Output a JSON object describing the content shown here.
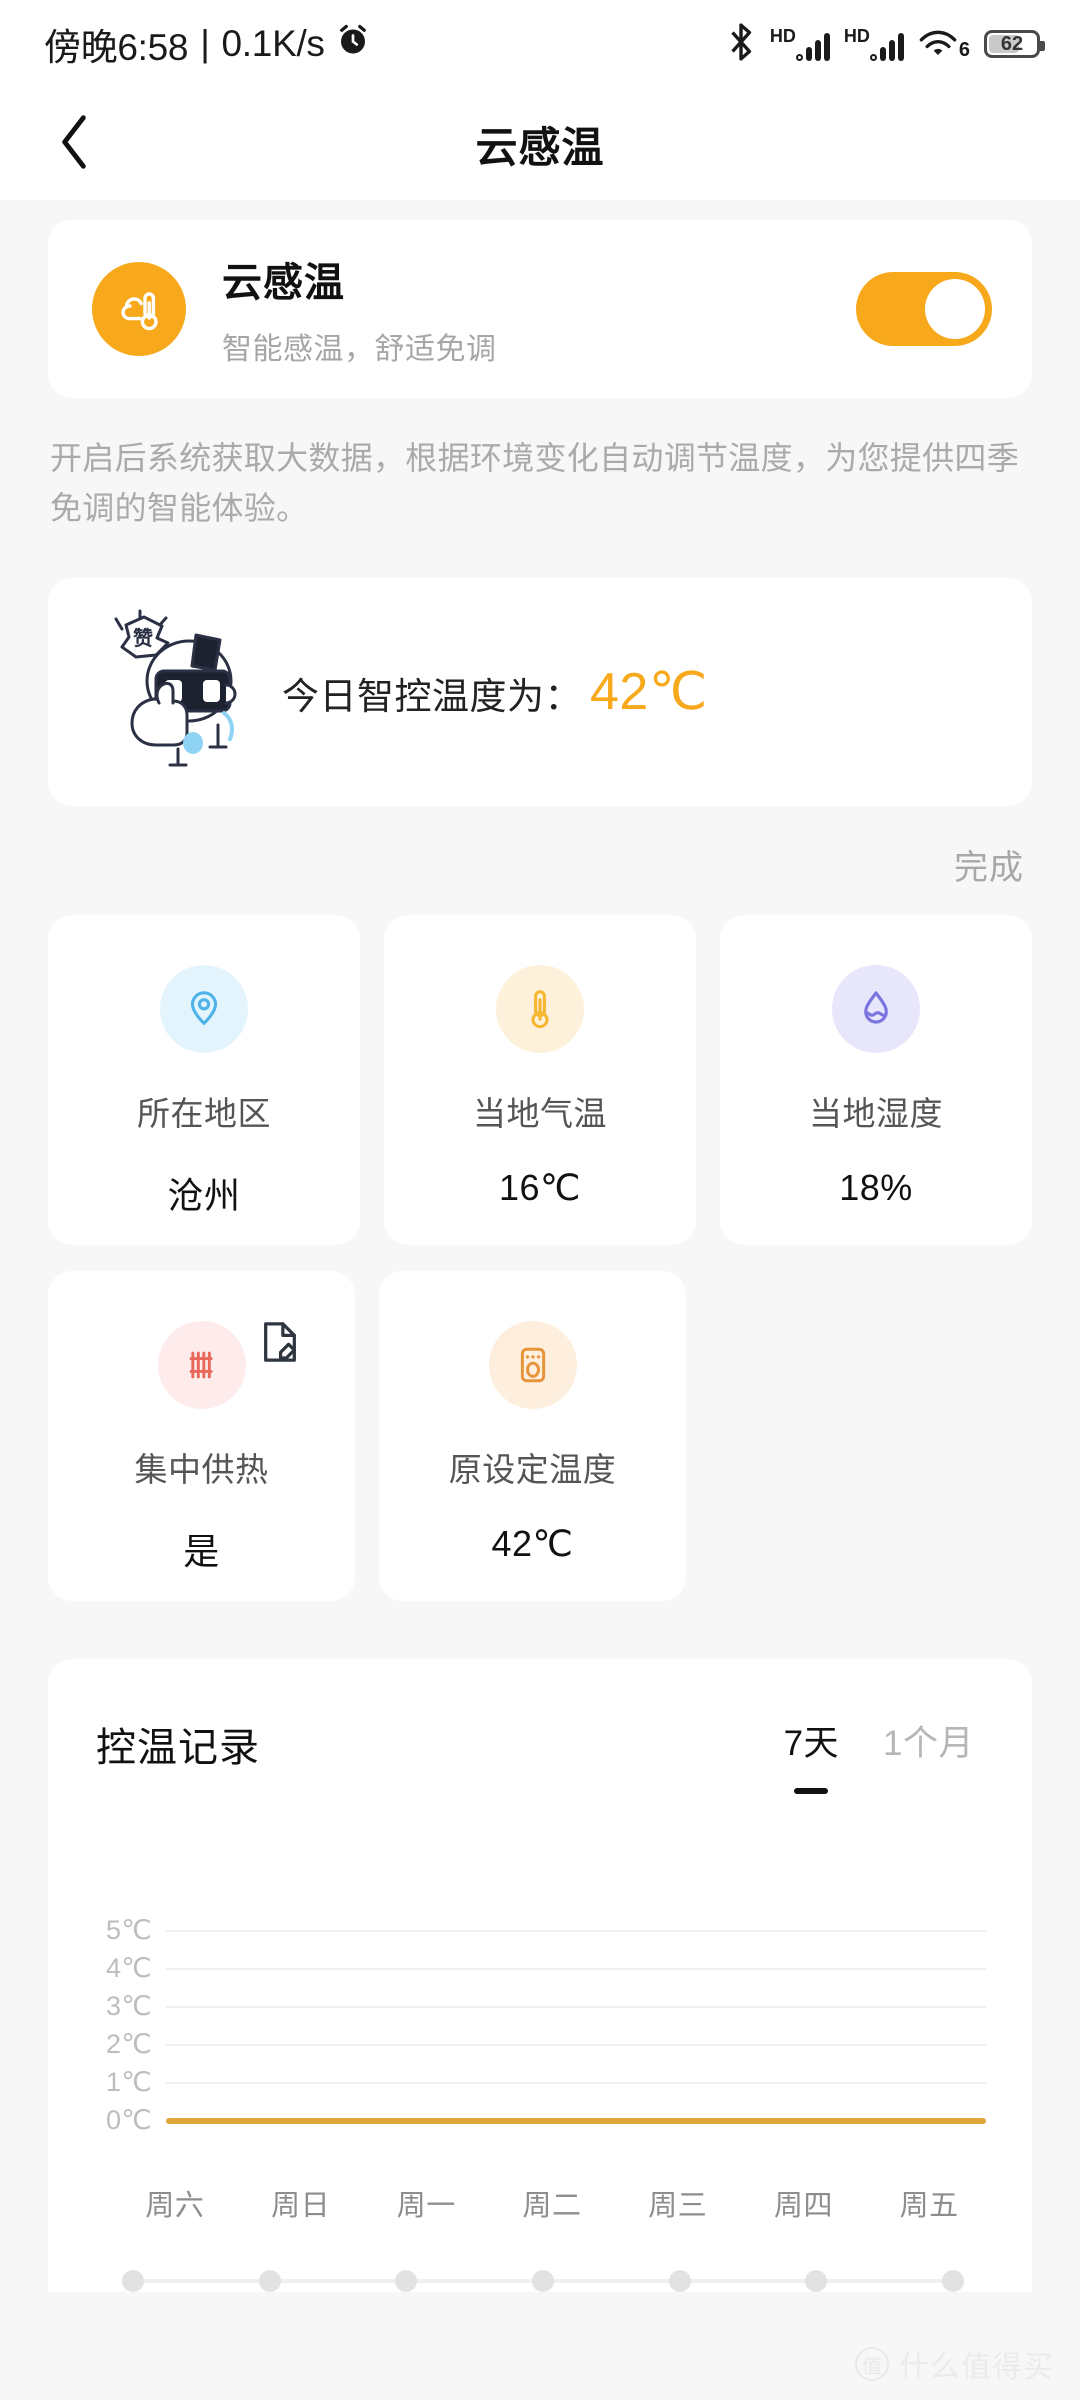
{
  "statusbar": {
    "time": "傍晚6:58",
    "separator": "|",
    "netspeed": "0.1K/s",
    "alarm_icon": "alarm-clock-icon",
    "bluetooth_icon": "bluetooth-icon",
    "sim1_label": "HD",
    "sim2_label": "HD",
    "wifi_label": "6",
    "battery_level": "62"
  },
  "nav": {
    "back_icon": "chevron-left-icon",
    "title": "云感温"
  },
  "feature": {
    "icon": "thermometer-cloud-icon",
    "title": "云感温",
    "subtitle": "智能感温，舒适免调",
    "toggle_on": true,
    "accent_color": "#f7a81b"
  },
  "description": "开启后系统获取大数据，根据环境变化自动调节温度，为您提供四季免调的智能体验。",
  "today": {
    "mascot_icon": "thumbs-up-mascot-icon",
    "mascot_text": "赞",
    "label": "今日智控温度为：",
    "value": "42℃",
    "value_color": "#f7a81b"
  },
  "done_label": "完成",
  "info_cards_row1": [
    {
      "icon": "location-pin-icon",
      "icon_bg": "#e3f4fd",
      "icon_color": "#4fb3e8",
      "label": "所在地区",
      "value": "沧州"
    },
    {
      "icon": "thermometer-icon",
      "icon_bg": "#fdf1dc",
      "icon_color": "#f5b731",
      "label": "当地气温",
      "value": "16℃"
    },
    {
      "icon": "water-drop-icon",
      "icon_bg": "#e7e6fb",
      "icon_color": "#7a74e0",
      "label": "当地湿度",
      "value": "18%"
    }
  ],
  "info_cards_row2": [
    {
      "icon": "radiator-icon",
      "icon_bg": "#fdeceb",
      "icon_color": "#e8685c",
      "label": "集中供热",
      "value": "是",
      "edit_icon": "document-edit-icon"
    },
    {
      "icon": "water-heater-icon",
      "icon_bg": "#fdeede",
      "icon_color": "#e8933a",
      "label": "原设定温度",
      "value": "42℃"
    }
  ],
  "chart_section": {
    "title": "控温记录",
    "tabs": [
      {
        "label": "7天",
        "active": true
      },
      {
        "label": "1个月",
        "active": false
      }
    ]
  },
  "chart_data": {
    "type": "line",
    "title": "控温记录",
    "xlabel": "",
    "ylabel": "",
    "categories": [
      "周六",
      "周日",
      "周一",
      "周二",
      "周三",
      "周四",
      "周五"
    ],
    "series": [
      {
        "name": "控温记录",
        "values": [
          0,
          0,
          0,
          0,
          0,
          0,
          0
        ],
        "color": "#dfa63a"
      }
    ],
    "y_ticks": [
      "5℃",
      "4℃",
      "3℃",
      "2℃",
      "1℃",
      "0℃"
    ],
    "ylim": [
      0,
      5
    ],
    "grid": true,
    "legend": "none"
  },
  "watermark": {
    "mark": "值",
    "text": "什么值得买"
  }
}
